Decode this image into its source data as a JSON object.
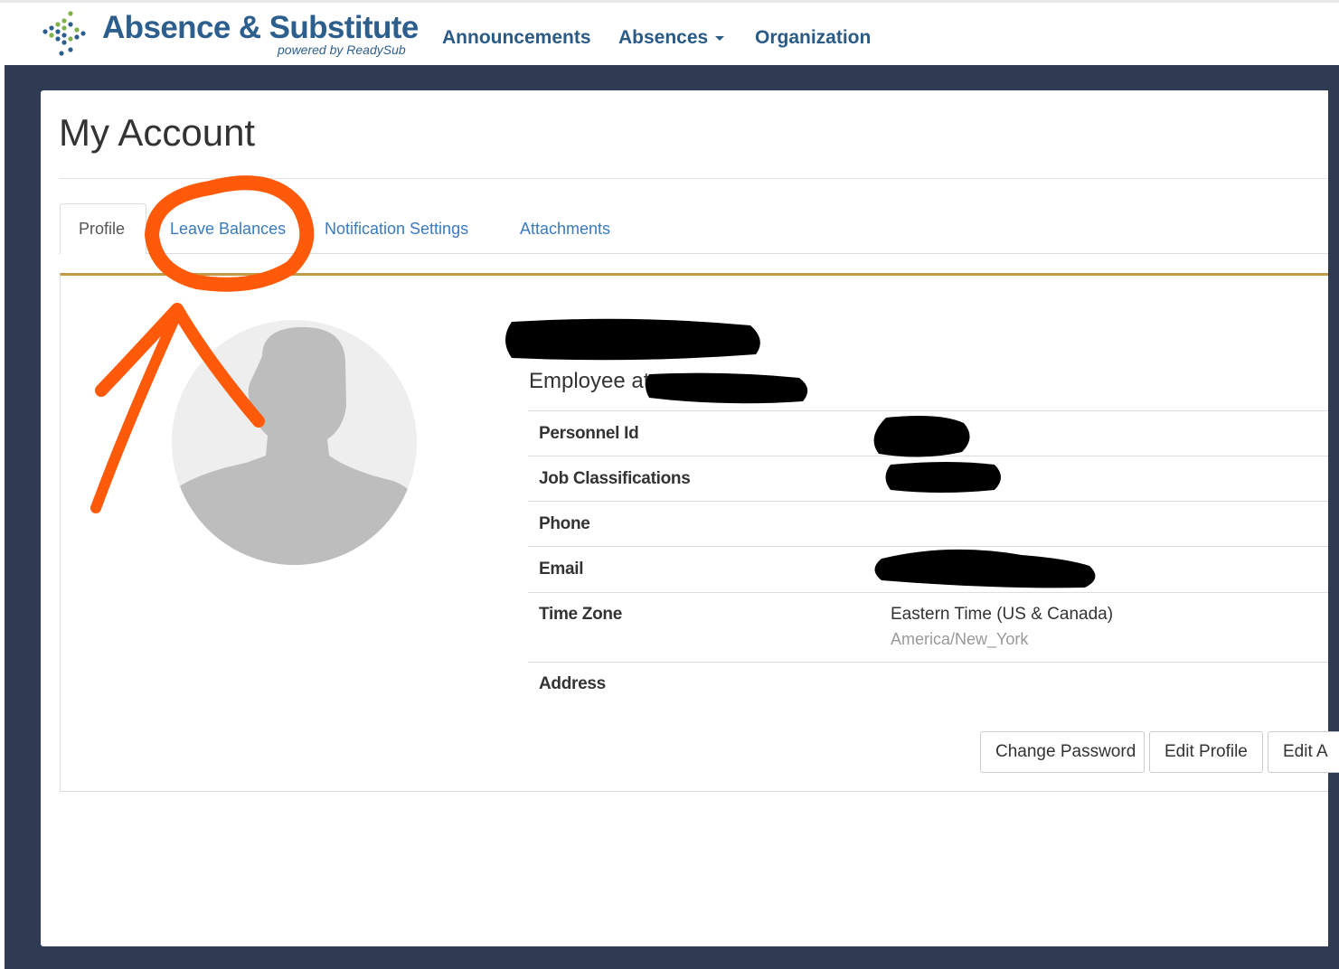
{
  "header": {
    "brand_title": "Absence & Substitute",
    "brand_subtitle": "powered by ReadySub",
    "nav": {
      "announcements": "Announcements",
      "absences": "Absences",
      "organization": "Organization"
    }
  },
  "page": {
    "title": "My Account"
  },
  "tabs": {
    "profile": "Profile",
    "leave_balances": "Leave Balances",
    "notification_settings": "Notification Settings",
    "attachments": "Attachments"
  },
  "profile": {
    "employee_prefix": "Employee at",
    "fields": {
      "personnel_id": "Personnel Id",
      "job_classifications": "Job Classifications",
      "phone": "Phone",
      "email": "Email",
      "time_zone": "Time Zone",
      "address": "Address"
    },
    "time_zone_value": "Eastern Time (US & Canada)",
    "time_zone_id": "America/New_York"
  },
  "buttons": {
    "change_password": "Change Password",
    "edit_profile": "Edit Profile",
    "edit_account": "Edit A"
  },
  "colors": {
    "brand_blue": "#2c5f8d",
    "frame": "#2e3b52",
    "tab_link": "#3a7bbf",
    "panel_accent": "#c29b48",
    "annotation": "#ff5a0a",
    "redaction": "#000000"
  }
}
